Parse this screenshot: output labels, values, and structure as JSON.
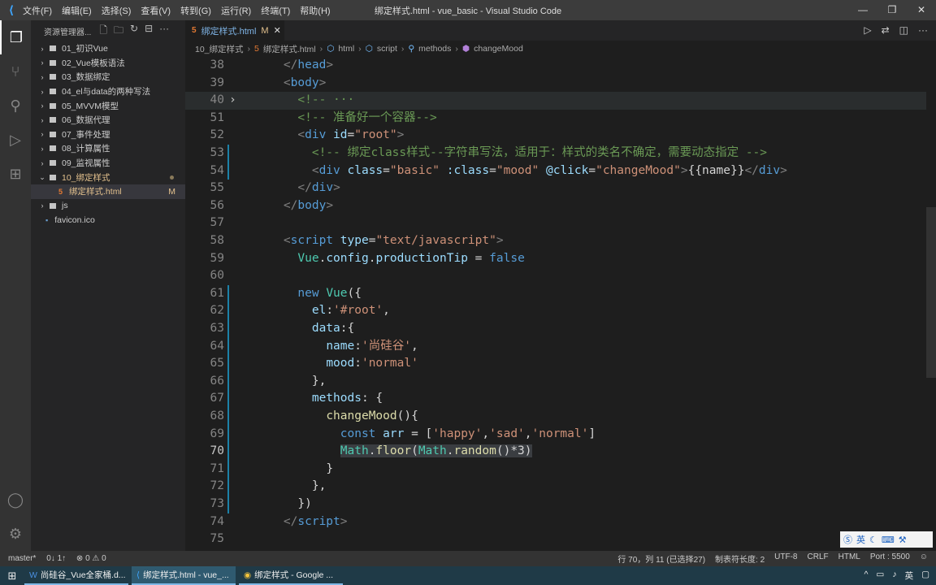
{
  "window": {
    "title": "绑定样式.html - vue_basic - Visual Studio Code",
    "menu": [
      "文件(F)",
      "编辑(E)",
      "选择(S)",
      "查看(V)",
      "转到(G)",
      "运行(R)",
      "终端(T)",
      "帮助(H)"
    ]
  },
  "sidebar": {
    "title": "资源管理器...",
    "items": [
      {
        "label": "01_初识Vue",
        "type": "folder"
      },
      {
        "label": "02_Vue模板语法",
        "type": "folder"
      },
      {
        "label": "03_数据绑定",
        "type": "folder"
      },
      {
        "label": "04_el与data的两种写法",
        "type": "folder"
      },
      {
        "label": "05_MVVM模型",
        "type": "folder"
      },
      {
        "label": "06_数据代理",
        "type": "folder"
      },
      {
        "label": "07_事件处理",
        "type": "folder"
      },
      {
        "label": "08_计算属性",
        "type": "folder"
      },
      {
        "label": "09_监视属性",
        "type": "folder"
      },
      {
        "label": "10_绑定样式",
        "type": "folder-open",
        "modified": true
      },
      {
        "label": "绑定样式.html",
        "type": "file",
        "badge": "M",
        "selected": true
      },
      {
        "label": "js",
        "type": "folder"
      },
      {
        "label": "favicon.ico",
        "type": "file"
      }
    ]
  },
  "tab": {
    "label": "绑定样式.html",
    "badge": "M"
  },
  "breadcrumb": [
    "10_绑定样式",
    "绑定样式.html",
    "html",
    "script",
    "methods",
    "changeMood"
  ],
  "code": [
    {
      "n": 38,
      "t": [
        [
          "    ",
          "x"
        ],
        [
          "</",
          "p"
        ],
        [
          "head",
          "t"
        ],
        [
          ">",
          "p"
        ]
      ]
    },
    {
      "n": 39,
      "t": [
        [
          "    ",
          "x"
        ],
        [
          "<",
          "p"
        ],
        [
          "body",
          "t"
        ],
        [
          ">",
          "p"
        ]
      ]
    },
    {
      "n": 40,
      "hl": true,
      "fold": true,
      "t": [
        [
          "      ",
          "x"
        ],
        [
          "<!-- ",
          "c"
        ],
        [
          "···",
          "c"
        ]
      ]
    },
    {
      "n": 51,
      "t": [
        [
          "      ",
          "x"
        ],
        [
          "<!-- 准备好一个容器-->",
          "c"
        ]
      ]
    },
    {
      "n": 52,
      "t": [
        [
          "      ",
          "x"
        ],
        [
          "<",
          "p"
        ],
        [
          "div",
          "t"
        ],
        [
          " id",
          "a"
        ],
        [
          "=",
          "x"
        ],
        [
          "\"root\"",
          "s"
        ],
        [
          ">",
          "p"
        ]
      ]
    },
    {
      "n": 53,
      "g": true,
      "t": [
        [
          "        ",
          "x"
        ],
        [
          "<!-- 绑定class样式--字符串写法，适用于：样式的类名不确定，需要动态指定 -->",
          "c"
        ]
      ]
    },
    {
      "n": 54,
      "g": true,
      "t": [
        [
          "        ",
          "x"
        ],
        [
          "<",
          "p"
        ],
        [
          "div",
          "t"
        ],
        [
          " class",
          "a"
        ],
        [
          "=",
          "x"
        ],
        [
          "\"basic\"",
          "s"
        ],
        [
          " :class",
          "a"
        ],
        [
          "=",
          "x"
        ],
        [
          "\"mood\"",
          "s"
        ],
        [
          " @click",
          "a"
        ],
        [
          "=",
          "x"
        ],
        [
          "\"changeMood\"",
          "s"
        ],
        [
          ">",
          "p"
        ],
        [
          "{{name}}",
          "x"
        ],
        [
          "</",
          "p"
        ],
        [
          "div",
          "t"
        ],
        [
          ">",
          "p"
        ]
      ]
    },
    {
      "n": 55,
      "t": [
        [
          "      ",
          "x"
        ],
        [
          "</",
          "p"
        ],
        [
          "div",
          "t"
        ],
        [
          ">",
          "p"
        ]
      ]
    },
    {
      "n": 56,
      "t": [
        [
          "    ",
          "x"
        ],
        [
          "</",
          "p"
        ],
        [
          "body",
          "t"
        ],
        [
          ">",
          "p"
        ]
      ]
    },
    {
      "n": 57,
      "t": []
    },
    {
      "n": 58,
      "t": [
        [
          "    ",
          "x"
        ],
        [
          "<",
          "p"
        ],
        [
          "script",
          "t"
        ],
        [
          " type",
          "a"
        ],
        [
          "=",
          "x"
        ],
        [
          "\"text/javascript\"",
          "s"
        ],
        [
          ">",
          "p"
        ]
      ]
    },
    {
      "n": 59,
      "t": [
        [
          "      ",
          "x"
        ],
        [
          "Vue",
          "cl"
        ],
        [
          ".",
          "x"
        ],
        [
          "config",
          "v"
        ],
        [
          ".",
          "x"
        ],
        [
          "productionTip",
          "v"
        ],
        [
          " = ",
          "x"
        ],
        [
          "false",
          "k"
        ]
      ]
    },
    {
      "n": 60,
      "t": []
    },
    {
      "n": 61,
      "g": true,
      "t": [
        [
          "      ",
          "x"
        ],
        [
          "new ",
          "k"
        ],
        [
          "Vue",
          "cl"
        ],
        [
          "({",
          "x"
        ]
      ]
    },
    {
      "n": 62,
      "g": true,
      "t": [
        [
          "        ",
          "x"
        ],
        [
          "el",
          "v"
        ],
        [
          ":",
          "x"
        ],
        [
          "'#root'",
          "s"
        ],
        [
          ",",
          "x"
        ]
      ]
    },
    {
      "n": 63,
      "g": true,
      "t": [
        [
          "        ",
          "x"
        ],
        [
          "data",
          "v"
        ],
        [
          ":{",
          "x"
        ]
      ]
    },
    {
      "n": 64,
      "g": true,
      "t": [
        [
          "          ",
          "x"
        ],
        [
          "name",
          "v"
        ],
        [
          ":",
          "x"
        ],
        [
          "'尚硅谷'",
          "s"
        ],
        [
          ",",
          "x"
        ]
      ]
    },
    {
      "n": 65,
      "g": true,
      "t": [
        [
          "          ",
          "x"
        ],
        [
          "mood",
          "v"
        ],
        [
          ":",
          "x"
        ],
        [
          "'normal'",
          "s"
        ]
      ]
    },
    {
      "n": 66,
      "g": true,
      "t": [
        [
          "        ",
          "x"
        ],
        [
          "},",
          "x"
        ]
      ]
    },
    {
      "n": 67,
      "g": true,
      "t": [
        [
          "        ",
          "x"
        ],
        [
          "methods",
          "v"
        ],
        [
          ": {",
          "x"
        ]
      ]
    },
    {
      "n": 68,
      "g": true,
      "t": [
        [
          "          ",
          "x"
        ],
        [
          "changeMood",
          "f"
        ],
        [
          "(){",
          "x"
        ]
      ]
    },
    {
      "n": 69,
      "g": true,
      "t": [
        [
          "            ",
          "x"
        ],
        [
          "const ",
          "k"
        ],
        [
          "arr",
          "v"
        ],
        [
          " = [",
          "x"
        ],
        [
          "'happy'",
          "s"
        ],
        [
          ",",
          "x"
        ],
        [
          "'sad'",
          "s"
        ],
        [
          ",",
          "x"
        ],
        [
          "'normal'",
          "s"
        ],
        [
          "]",
          "x"
        ]
      ]
    },
    {
      "n": 70,
      "g": true,
      "cur": true,
      "t": [
        [
          "            ",
          "x"
        ],
        [
          "Math",
          "cl",
          "sel"
        ],
        [
          ".",
          "x",
          "sel"
        ],
        [
          "floor",
          "f",
          "sel"
        ],
        [
          "(",
          "x",
          "sel"
        ],
        [
          "Math",
          "cl",
          "sel"
        ],
        [
          ".",
          "x",
          "sel"
        ],
        [
          "random",
          "f",
          "sel"
        ],
        [
          "()*3)",
          "x",
          "sel"
        ]
      ]
    },
    {
      "n": 71,
      "g": true,
      "t": [
        [
          "          ",
          "x"
        ],
        [
          "}",
          "x"
        ]
      ]
    },
    {
      "n": 72,
      "g": true,
      "t": [
        [
          "        ",
          "x"
        ],
        [
          "},",
          "x"
        ]
      ]
    },
    {
      "n": 73,
      "g": true,
      "t": [
        [
          "      ",
          "x"
        ],
        [
          "})",
          "x"
        ]
      ]
    },
    {
      "n": 74,
      "t": [
        [
          "    ",
          "x"
        ],
        [
          "</",
          "p"
        ],
        [
          "script",
          "t"
        ],
        [
          ">",
          "p"
        ]
      ]
    },
    {
      "n": 75,
      "t": []
    }
  ],
  "status": {
    "branch": "master*",
    "sync": "0↓ 1↑",
    "problems": "⊗ 0 ⚠ 0",
    "position": "行 70，列 11 (已选择27)",
    "indent": "制表符长度: 2",
    "encoding": "UTF-8",
    "eol": "CRLF",
    "language": "HTML",
    "port": "Port : 5500"
  },
  "taskbar": {
    "tasks": [
      "尚硅谷_Vue全家桶.d...",
      "绑定样式.html - vue_...",
      "绑定样式 - Google ..."
    ],
    "ime": "英"
  }
}
